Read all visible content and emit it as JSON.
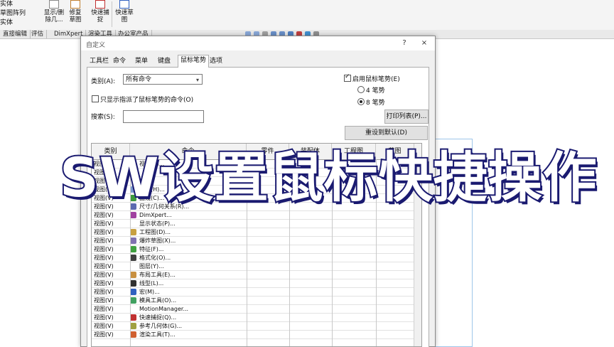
{
  "ribbon": {
    "left_items": [
      "实体",
      "草图阵列",
      "实体"
    ],
    "buttons": [
      {
        "label": "显示/删除几..."
      },
      {
        "label": "修复草图"
      },
      {
        "label": "快速捕捉"
      },
      {
        "label": "快速草图"
      }
    ]
  },
  "cm_tabs": [
    "直接编辑",
    "评估",
    "DimXpert",
    "渲染工具",
    "办公室产品"
  ],
  "dialog": {
    "title": "自定义",
    "help": "?",
    "close": "×",
    "tabs": [
      "工具栏",
      "命令",
      "菜单",
      "键盘",
      "鼠标笔势",
      "选项"
    ],
    "active_tab": "鼠标笔势",
    "category_label": "类别(A):",
    "category_value": "所有命令",
    "only_assigned_label": "只显示指派了鼠标笔势的命令(O)",
    "search_label": "搜索(S):",
    "search_value": "",
    "enable_gestures_label": "启用鼠标笔势(E)",
    "gesture4_label": "4 笔势",
    "gesture8_label": "8 笔势",
    "print_button": "打印列表(P)...",
    "reset_button": "重设到默认(D)",
    "columns": [
      "类别",
      "命令",
      "零件",
      "装配体",
      "工程图",
      "草图"
    ],
    "rows": [
      {
        "category": "视图(V)",
        "command": "视图(V)...",
        "icon_color": "#5b8fd6"
      },
      {
        "category": "视图(V)",
        "command": "",
        "icon_color": "#ffffff"
      },
      {
        "category": "视图(V)",
        "command": "",
        "icon_color": "#ffffff"
      },
      {
        "category": "视图(V)",
        "command": "基准(H)...",
        "icon_color": "#7a9ad0"
      },
      {
        "category": "视图(V)",
        "command": "曲线(C)...",
        "icon_color": "#3c9a3c"
      },
      {
        "category": "视图(V)",
        "command": "尺寸/几何关系(R)...",
        "icon_color": "#5c6ab0"
      },
      {
        "category": "视图(V)",
        "command": "DimXpert...",
        "icon_color": "#a040a0"
      },
      {
        "category": "视图(V)",
        "command": "显示状态(P)...",
        "icon_color": "#ffffff"
      },
      {
        "category": "视图(V)",
        "command": "工程图(D)...",
        "icon_color": "#c8a040"
      },
      {
        "category": "视图(V)",
        "command": "爆炸草图(X)...",
        "icon_color": "#8070b0"
      },
      {
        "category": "视图(V)",
        "command": "特征(F)...",
        "icon_color": "#40a040"
      },
      {
        "category": "视图(V)",
        "command": "格式化(O)...",
        "icon_color": "#404040"
      },
      {
        "category": "视图(V)",
        "command": "图层(Y)...",
        "icon_color": "#ffffff"
      },
      {
        "category": "视图(V)",
        "command": "布局工具(E)...",
        "icon_color": "#c89040"
      },
      {
        "category": "视图(V)",
        "command": "线型(L)...",
        "icon_color": "#303030"
      },
      {
        "category": "视图(V)",
        "command": "宏(M)...",
        "icon_color": "#3060c0"
      },
      {
        "category": "视图(V)",
        "command": "模具工具(O)...",
        "icon_color": "#40a060"
      },
      {
        "category": "视图(V)",
        "command": "MotionManager...",
        "icon_color": "#ffffff"
      },
      {
        "category": "视图(V)",
        "command": "快速捕捉(Q)...",
        "icon_color": "#c03030"
      },
      {
        "category": "视图(V)",
        "command": "参考几何体(G)...",
        "icon_color": "#a0a040"
      },
      {
        "category": "视图(V)",
        "command": "渲染工具(T)...",
        "icon_color": "#d06030"
      }
    ]
  },
  "overlay_title": "SW设置鼠标快捷操作"
}
